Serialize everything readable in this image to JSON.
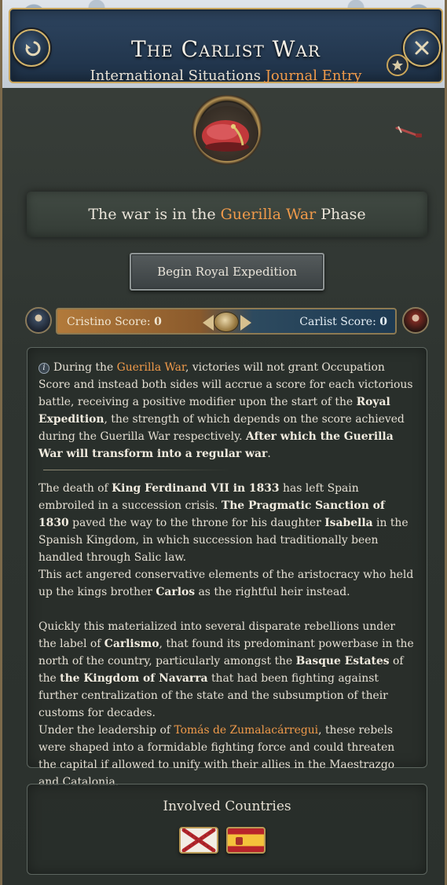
{
  "header": {
    "title": "The Carlist War",
    "subtitle_prefix": "International Situations",
    "subtitle_highlight": "Journal Entry"
  },
  "icons": {
    "back": "back-arrow-icon",
    "close": "close-icon",
    "star": "star-icon",
    "emblem": "red-beret-icon",
    "musket": "musket-icon"
  },
  "phase": {
    "prefix": "The war is in the",
    "highlight": "Guerilla War",
    "suffix": "Phase"
  },
  "action_button": {
    "label": "Begin Royal Expedition"
  },
  "score": {
    "left_label": "Cristino Score:",
    "left_value": "0",
    "right_label": "Carlist Score:",
    "right_value": "0",
    "balance": 0.5
  },
  "description": {
    "p1": {
      "t1": "During the ",
      "h1": "Guerilla War",
      "t2": ", victories will not grant Occupation Score and instead both sides will accrue a score for each victorious battle, receiving a positive modifier upon the start of the ",
      "b1": "Royal Expedition",
      "t3": ", the strength of which depends on the score achieved during the Guerilla War respectively. ",
      "b2": "After which the Guerilla War will transform into a regular war",
      "t4": "."
    },
    "p2": {
      "t1": "The death of ",
      "b1": "King Ferdinand VII in 1833",
      "t2": " has left Spain embroiled in a succession crisis. ",
      "b2": "The Pragmatic Sanction of 1830",
      "t3": " paved the way to the throne for his daughter ",
      "b3": "Isabella",
      "t4": " in the Spanish Kingdom, in which succession had traditionally been handled through Salic law."
    },
    "p3": {
      "t1": "This act angered conservative elements of the aristocracy who held up the kings brother ",
      "b1": "Carlos",
      "t2": " as the rightful heir instead."
    },
    "p4": {
      "t1": "Quickly this materialized into several disparate rebellions under the label of ",
      "b1": "Carlismo",
      "t2": ", that found its predominant powerbase in the north of the country, particularly amongst the ",
      "b2": "Basque Estates",
      "t3": " of the ",
      "b3": "the Kingdom of Navarra",
      "t4": " that had been fighting against further centralization of the state and the subsumption of their customs for decades."
    },
    "p5": {
      "t1": "Under the leadership of ",
      "h1": "Tomás de Zumalacárregui",
      "t2": ", these rebels were shaped into a formidable fighting force and could threaten the capital if allowed to unify with their allies in the Maestrazgo and Catalonia."
    }
  },
  "countries": {
    "title": "Involved Countries",
    "flags": [
      "Cross of Burgundy flag",
      "Spain flag"
    ]
  },
  "colors": {
    "highlight": "#f09a4a",
    "gold_border": "#c9a55a",
    "header_blue": "#2e4560",
    "panel_bg": "#2f3531"
  }
}
